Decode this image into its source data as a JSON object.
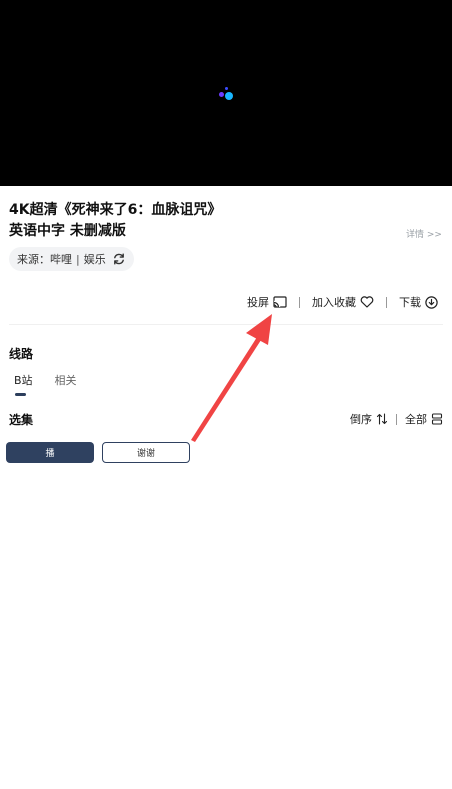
{
  "video": {
    "title": "4K超清《死神来了6：血脉诅咒》英语中字 未删减版",
    "detail_link": "详情 >>"
  },
  "source": {
    "label": "来源：",
    "platform": "哔哩",
    "separator": "|",
    "category": "娱乐",
    "refresh_icon": "refresh-icon"
  },
  "actions": {
    "cast_label": "投屏",
    "favorite_label": "加入收藏",
    "download_label": "下载"
  },
  "routes": {
    "heading": "线路",
    "tabs": [
      {
        "label": "B站",
        "active": true
      },
      {
        "label": "相关",
        "active": false
      }
    ]
  },
  "episodes": {
    "heading": "选集",
    "sort_label": "倒序",
    "all_label": "全部",
    "items": [
      {
        "label": "播",
        "selected": true
      },
      {
        "label": "谢谢",
        "selected": false
      }
    ]
  },
  "colors": {
    "accent": "#2f4160",
    "annotation_arrow": "#f04444",
    "player_bg": "#000000"
  }
}
